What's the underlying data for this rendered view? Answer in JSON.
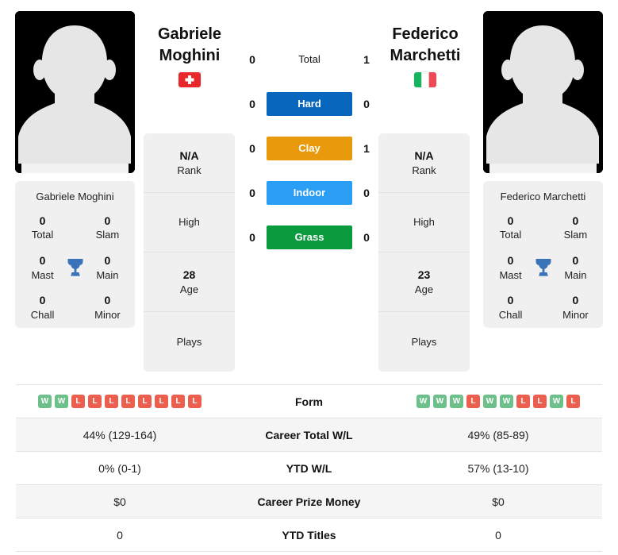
{
  "players": {
    "left": {
      "first_name": "Gabriele",
      "last_name": "Moghini",
      "full_name": "Gabriele Moghini",
      "country": "Switzerland",
      "flag_icon": "flag-switzerland",
      "avatar_icon": "player-photo-placeholder",
      "rank_value": "N/A",
      "rank_label": "Rank",
      "high_label": "High",
      "high_value": "",
      "age_value": "28",
      "age_label": "Age",
      "plays_label": "Plays",
      "plays_value": "",
      "titles": {
        "total_value": "0",
        "total_label": "Total",
        "slam_value": "0",
        "slam_label": "Slam",
        "mast_value": "0",
        "mast_label": "Mast",
        "main_value": "0",
        "main_label": "Main",
        "chall_value": "0",
        "chall_label": "Chall",
        "minor_value": "0",
        "minor_label": "Minor"
      },
      "form": [
        "W",
        "W",
        "L",
        "L",
        "L",
        "L",
        "L",
        "L",
        "L",
        "L"
      ],
      "career_total_wl": "44% (129-164)",
      "ytd_wl": "0% (0-1)",
      "career_prize_money": "$0",
      "ytd_titles": "0"
    },
    "right": {
      "first_name": "Federico",
      "last_name": "Marchetti",
      "full_name": "Federico Marchetti",
      "country": "Italy",
      "flag_icon": "flag-italy",
      "avatar_icon": "player-photo-placeholder",
      "rank_value": "N/A",
      "rank_label": "Rank",
      "high_label": "High",
      "high_value": "",
      "age_value": "23",
      "age_label": "Age",
      "plays_label": "Plays",
      "plays_value": "",
      "titles": {
        "total_value": "0",
        "total_label": "Total",
        "slam_value": "0",
        "slam_label": "Slam",
        "mast_value": "0",
        "mast_label": "Mast",
        "main_value": "0",
        "main_label": "Main",
        "chall_value": "0",
        "chall_label": "Chall",
        "minor_value": "0",
        "minor_label": "Minor"
      },
      "form": [
        "W",
        "W",
        "W",
        "L",
        "W",
        "W",
        "L",
        "L",
        "W",
        "L"
      ],
      "career_total_wl": "49% (85-89)",
      "ytd_wl": "57% (13-10)",
      "career_prize_money": "$0",
      "ytd_titles": "0"
    }
  },
  "head_to_head": [
    {
      "label": "Total",
      "left": "0",
      "right": "1",
      "color": "",
      "style": "plain"
    },
    {
      "label": "Hard",
      "left": "0",
      "right": "0",
      "color": "#0866bd",
      "style": "surface"
    },
    {
      "label": "Clay",
      "left": "0",
      "right": "1",
      "color": "#e8990c",
      "style": "surface"
    },
    {
      "label": "Indoor",
      "left": "0",
      "right": "0",
      "color": "#2a9df4",
      "style": "surface"
    },
    {
      "label": "Grass",
      "left": "0",
      "right": "0",
      "color": "#0b9b3f",
      "style": "surface"
    }
  ],
  "stats_rows": [
    {
      "label": "Form",
      "left": "",
      "right": "",
      "type": "form"
    },
    {
      "label": "Career Total W/L",
      "left": "44% (129-164)",
      "right": "49% (85-89)",
      "type": "text"
    },
    {
      "label": "YTD W/L",
      "left": "0% (0-1)",
      "right": "57% (13-10)",
      "type": "text"
    },
    {
      "label": "Career Prize Money",
      "left": "$0",
      "right": "$0",
      "type": "text"
    },
    {
      "label": "YTD Titles",
      "left": "0",
      "right": "0",
      "type": "text"
    }
  ],
  "colors": {
    "hard": "#0866bd",
    "clay": "#e8990c",
    "indoor": "#2a9df4",
    "grass": "#0b9b3f",
    "win_badge": "#6ec08a",
    "loss_badge": "#ec5f4f",
    "card_bg": "#f0f0f0",
    "trophy": "#3b73b9"
  }
}
